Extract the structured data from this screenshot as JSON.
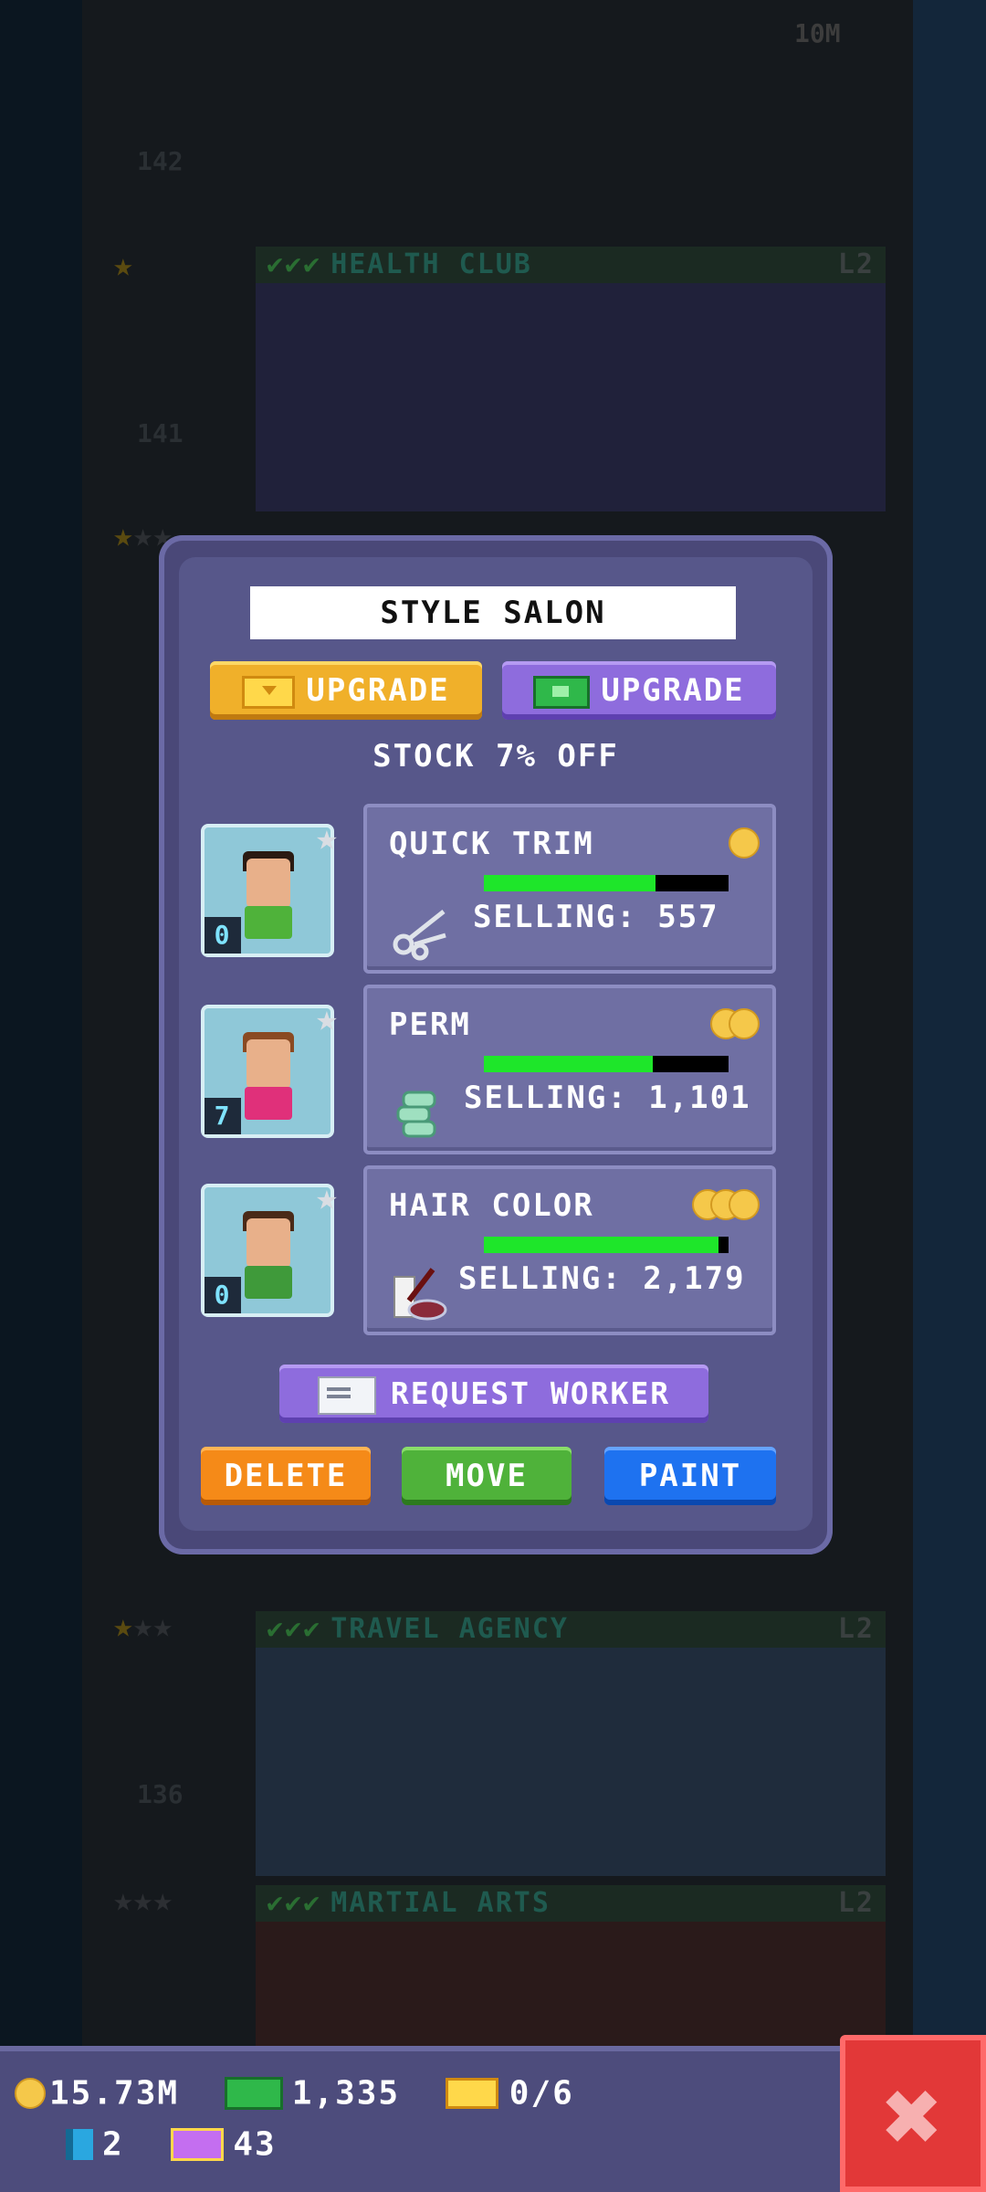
{
  "background": {
    "floors": [
      {
        "name": "HEALTH CLUB",
        "level": "L2",
        "number": "141"
      },
      {
        "name": "TRAVEL AGENCY",
        "level": "L2",
        "number": "136"
      },
      {
        "name": "MARTIAL ARTS",
        "level": "L2",
        "number": ""
      }
    ],
    "top_floor_number": "142",
    "top_price": "10M",
    "checks": "✔✔✔"
  },
  "dialog": {
    "title": "STYLE SALON",
    "upgrade_bux_label": "UPGRADE",
    "upgrade_cash_label": "UPGRADE",
    "stock_text": "STOCK 7% OFF",
    "products": [
      {
        "name": "QUICK TRIM",
        "selling": "SELLING: 557",
        "coins": 1,
        "stock_fraction": 0.7,
        "icon": "scissors-icon"
      },
      {
        "name": "PERM",
        "selling": "SELLING: 1,101",
        "coins": 2,
        "stock_fraction": 0.69,
        "icon": "curlers-icon"
      },
      {
        "name": "HAIR COLOR",
        "selling": "SELLING: 2,179",
        "coins": 3,
        "stock_fraction": 0.96,
        "icon": "hair-dye-icon"
      }
    ],
    "workers": [
      {
        "count": "0",
        "hair": "#2a1a12",
        "shirt": "#4fb23a"
      },
      {
        "count": "7",
        "hair": "#8a4a22",
        "shirt": "#e0307a"
      },
      {
        "count": "0",
        "hair": "#4a2a18",
        "shirt": "#3f9a3a"
      }
    ],
    "request_worker_label": "REQUEST WORKER",
    "delete_label": "DELETE",
    "move_label": "MOVE",
    "paint_label": "PAINT"
  },
  "hud": {
    "coins": "15.73M",
    "cash": "1,335",
    "bux": "0/6",
    "gems": "2",
    "tickets": "43",
    "close_icon": "close-icon"
  }
}
